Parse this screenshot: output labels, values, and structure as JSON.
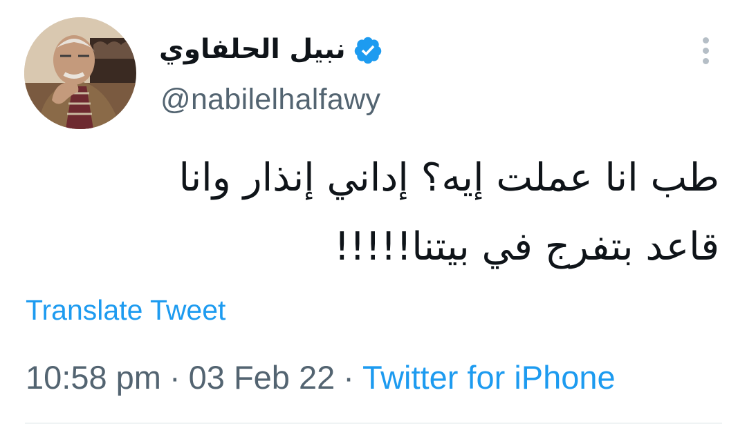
{
  "user": {
    "display_name": "نبيل الحلفاوي",
    "handle": "@nabilelhalfawy",
    "verified": true,
    "verified_icon": "verified-badge-icon"
  },
  "tweet": {
    "text_line_1": "طب انا عملت إيه؟ إداني إنذار وانا",
    "text_line_2": "قاعد بتفرج في بيتنا!!!!!",
    "translate_label": "Translate Tweet",
    "time": "10:58 pm",
    "separator": "·",
    "date": "03 Feb 22",
    "source": "Twitter for iPhone"
  },
  "icons": {
    "more": "more-vertical-icon"
  },
  "colors": {
    "text": "#0f1419",
    "secondary": "#536471",
    "accent": "#1d9bf0",
    "icon_gray": "#b5bec6"
  }
}
